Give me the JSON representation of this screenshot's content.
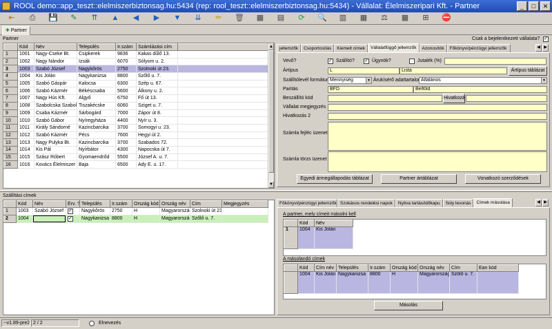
{
  "window": {
    "title": "ROOL demo::app_teszt::elelmiszerbiztonsag.hu:5434 (rep: rool_teszt::elelmiszerbiztonsag.hu:5434) - Vállalat: Élelmiszeripari Kft. - Partner",
    "minimize": "_",
    "maximize": "□",
    "close": "✕"
  },
  "toolbar": [
    "⇤",
    "⎙",
    "💾",
    "✎",
    "⇈",
    "▲",
    "◀",
    "▶",
    "▼",
    "⇊",
    "✏",
    "🗑",
    "▦",
    "▤",
    "⟳",
    "🔍",
    "▥",
    "▦",
    "⚖",
    "▦",
    "⊞",
    "⛔"
  ],
  "main_tab": "Partner",
  "partner": {
    "section_label": "Partner",
    "columns": [
      "Kód",
      "Név",
      "Település",
      "Ir.szám",
      "Számlázási cím"
    ],
    "rows": [
      [
        "1",
        "1001",
        "Nagy-Cseke Bt.",
        "Csipkerek",
        "9836",
        "Kakas dűlő 13."
      ],
      [
        "2",
        "1002",
        "Nagy Nándor",
        "Izsák",
        "6070",
        "Sólyom u. 2."
      ],
      [
        "3",
        "1003",
        "Szabó József",
        "Nagykőrös",
        "2750",
        "Szolnoki út 23."
      ],
      [
        "4",
        "1004",
        "Kis Jolán",
        "Nagykanizsa",
        "8800",
        "Szőlő u. 7."
      ],
      [
        "5",
        "1005",
        "Szabó Gáspár",
        "Kalocsa",
        "6300",
        "Szép u. 67."
      ],
      [
        "6",
        "1006",
        "Szabó Kázmér",
        "Békéscsaba",
        "5600",
        "Álkony u. 2."
      ],
      [
        "7",
        "1007",
        "Nagy Hús Kft.",
        "Algyő",
        "6750",
        "Fő út 13."
      ],
      [
        "8",
        "1008",
        "Szabolcska Szabolcs",
        "Tiszakécske",
        "6060",
        "Sziget u. 7."
      ],
      [
        "9",
        "1009",
        "Csaba Kázmér",
        "Sárbogárd",
        "7000",
        "Zápor út 8."
      ],
      [
        "10",
        "1010",
        "Szabó Gábor",
        "Nyíregyháza",
        "4400",
        "Nyír u. 3."
      ],
      [
        "11",
        "1011",
        "Király Sándorné",
        "Kazincbarcika",
        "3700",
        "Somogyi u. 23."
      ],
      [
        "12",
        "1012",
        "Szabó Kázmér",
        "Pécs",
        "7600",
        "Hegyi út 2."
      ],
      [
        "13",
        "1013",
        "Nagy Pulyka Bt.",
        "Kazincbarcika",
        "3700",
        "Szabados 72."
      ],
      [
        "14",
        "1014",
        "Kis Pál",
        "Nyírbátor",
        "4300",
        "Napocska út 7."
      ],
      [
        "15",
        "1015",
        "Szász Róbert",
        "Gyomaendrőd",
        "5500",
        "József A. u. 7."
      ],
      [
        "16",
        "1016",
        "Kovács Élelmiszer Kft",
        "Baja",
        "6500",
        "Ady E. u. 17."
      ]
    ]
  },
  "right": {
    "only_registered": "Csak a bejelentkezett vállalata?",
    "only_registered_checked": "✓",
    "tabs": [
      "jellemzők",
      "Csoportosítás",
      "Kiemelt címek",
      "Vállalatfüggő jellemzők",
      "Azonosítók",
      "Főkönyvi/pénzügyi jellemzők"
    ],
    "active_tab": "Vállalatfüggő jellemzők",
    "vevo": "Vevő?",
    "szallito": "Szállító?",
    "ugynok": "Ügynök?",
    "jutalek": "Jutalék (%)",
    "artipus": "Ártípus",
    "artipus_val": "L",
    "artipus_text": "Lista",
    "arlista_btn": "Ártípus táblázat",
    "szallitolevel": "Szállítólevél formátum",
    "szallitolevel_val": "Mennyiség",
    "arukiserő": "Árukísérő adattartalom",
    "arukisero_val": "Általános",
    "paritas": "Paritás",
    "paritas_val": "BFD",
    "paritas_text": "Belföld",
    "beszallito_kod": "Beszállító kód",
    "hivatkozas_btn": "Hivatkozás",
    "vallalat_megj": "Vállalat megjegyzés",
    "hivatkozas2": "Hivatkozás 2",
    "szamla_fejlec": "Számla fejléc üzenet",
    "szamla_torzs": "Számla törzs üzenet",
    "btn_egyedi": "Egyedi ármegállapodás táblázat",
    "btn_partner_ar": "Partner ártáblázat",
    "btn_szerzodes": "Vonatkozó szerződések"
  },
  "shipping": {
    "section_label": "Szállítási címek",
    "columns": [
      "Kód",
      "Név",
      "Érv. ?",
      "Település",
      "Ir.szám",
      "Ország kód",
      "Ország név",
      "Cím",
      "Megjegyzés"
    ],
    "rows": [
      {
        "rh": "1",
        "kod": "1003",
        "nev": "Szabó József",
        "erv": "✓",
        "telepules": "Nagykőrös",
        "irszam": "2750",
        "orszagkod": "H",
        "orszagnev": "Magyarország",
        "cim": "Szolnoki út 23.",
        "megj": ""
      },
      {
        "rh": "2",
        "kod": "1004",
        "nev": "",
        "erv": "✓",
        "telepules": "Nagykanizsa",
        "irszam": "8800",
        "orszagkod": "H",
        "orszagnev": "Magyarország",
        "cim": "Szőlő u. 7.",
        "megj": ""
      }
    ]
  },
  "copy": {
    "tabs": [
      "Főkönyvi/pénzügyi jellemzők",
      "Szokásos rendelési napok",
      "Nyitva tartás/időkapu",
      "Súly levonás",
      "Címek másolása"
    ],
    "active_tab": "Címek másolása",
    "source_label": "A partner, mely címeit másolni kell",
    "source_columns": [
      "Kód",
      "Név"
    ],
    "source_rows": [
      [
        "1",
        "1004",
        "Kis Jolán"
      ]
    ],
    "target_label": "A másolandó címek",
    "target_columns": [
      "Kód",
      "Cím név",
      "Település",
      "Ir.szám",
      "Ország kód",
      "Ország név",
      "Cím",
      "Ean kód"
    ],
    "target_rows": [
      [
        "1004",
        "Kis Jolán",
        "Nagykanizsa",
        "8800",
        "H",
        "Magyarország",
        "Szőlő u. 7.",
        ""
      ]
    ],
    "copy_btn": "Másolás"
  },
  "status": {
    "version": "--v1.89-pre29",
    "records": "2 / 2",
    "elnevezes": "Elnevezés"
  }
}
